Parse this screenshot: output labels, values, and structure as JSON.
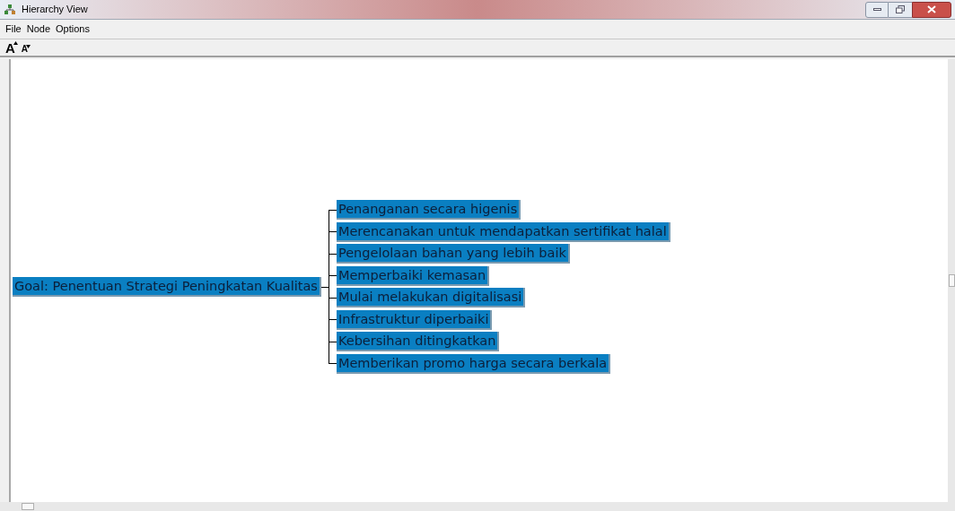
{
  "window": {
    "title": "Hierarchy View"
  },
  "menu": [
    "File",
    "Node",
    "Options"
  ],
  "toolbar": [
    {
      "kind": "grow",
      "glyph": "A"
    },
    {
      "kind": "shrink",
      "glyph": "A"
    }
  ],
  "tree": {
    "label": "Goal: Penentuan Strategi Peningkatan Kualitas",
    "selected": true,
    "children": [
      {
        "label": "Penanganan secara higenis",
        "selected": true
      },
      {
        "label": "Merencanakan untuk mendapatkan sertifikat halal",
        "selected": true
      },
      {
        "label": "Pengelolaan bahan yang lebih baik",
        "selected": true
      },
      {
        "label": "Memperbaiki kemasan",
        "selected": true
      },
      {
        "label": "Mulai melakukan digitalisasi",
        "selected": true
      },
      {
        "label": "Infrastruktur diperbaiki",
        "selected": true
      },
      {
        "label": "Kebersihan ditingkatkan",
        "selected": true
      },
      {
        "label": "Memberikan promo harga secara berkala",
        "selected": true
      }
    ]
  }
}
